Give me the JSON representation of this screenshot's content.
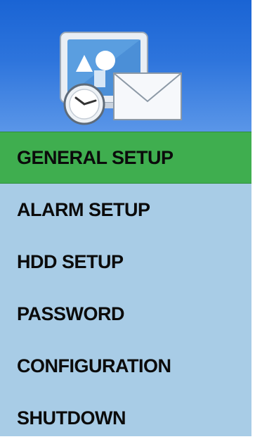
{
  "header": {
    "logo_icon": "computer-clock-envelope-icon"
  },
  "menu": {
    "items": [
      {
        "label": "GENERAL SETUP",
        "active": true
      },
      {
        "label": "ALARM SETUP",
        "active": false
      },
      {
        "label": "HDD SETUP",
        "active": false
      },
      {
        "label": "PASSWORD",
        "active": false
      },
      {
        "label": "CONFIGURATION",
        "active": false
      },
      {
        "label": "SHUTDOWN",
        "active": false
      }
    ]
  },
  "colors": {
    "header_blue": "#2d74dc",
    "menu_background": "#a8cce6",
    "active_green": "#3fae4f"
  }
}
